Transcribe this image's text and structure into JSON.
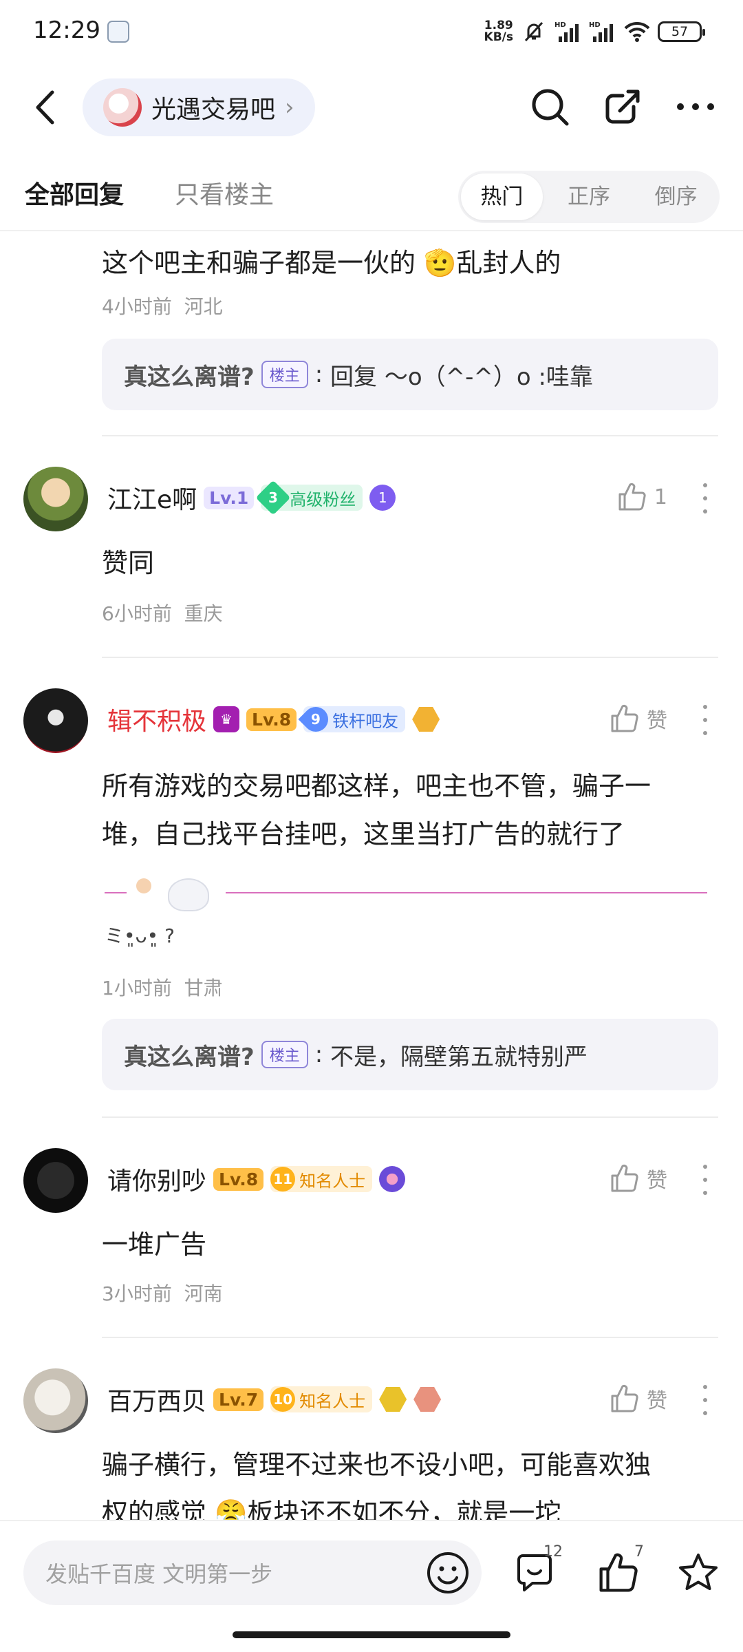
{
  "status_bar": {
    "time": "12:29",
    "net_speed_value": "1.89",
    "net_speed_unit": "KB/s",
    "battery": "57"
  },
  "nav": {
    "forum_name": "光遇交易吧"
  },
  "tabs": {
    "all": "全部回复",
    "owner_only": "只看楼主",
    "sort_hot": "热门",
    "sort_asc": "正序",
    "sort_desc": "倒序"
  },
  "comments": [
    {
      "text": "这个吧主和骗子都是一伙的 🫡乱封人的",
      "time": "4小时前",
      "location": "河北",
      "reply": {
        "name": "真这么离谱?",
        "tag": "楼主",
        "text": "回复 ～o（^-^）o :哇靠"
      }
    },
    {
      "user": "江江e啊",
      "level": "Lv.1",
      "fan_num": "3",
      "fan_title": "高级粉丝",
      "like_label": "1",
      "text": "赞同",
      "time": "6小时前",
      "location": "重庆"
    },
    {
      "user": "辑不积极",
      "level": "Lv.8",
      "fan_num": "9",
      "fan_title": "铁杆吧友",
      "like_label": "赞",
      "text_line1": "所有游戏的交易吧都这样，吧主也不管，骗子一",
      "text_line2": "堆，自己找平台挂吧，这里当打广告的就行了",
      "sig_text": "ミ•͈ᴗ•͈ ?",
      "time": "1小时前",
      "location": "甘肃",
      "reply": {
        "name": "真这么离谱?",
        "tag": "楼主",
        "text": "不是，隔壁第五就特别严"
      }
    },
    {
      "user": "请你别吵",
      "level": "Lv.8",
      "fan_num": "11",
      "fan_title": "知名人士",
      "like_label": "赞",
      "text": "一堆广告",
      "time": "3小时前",
      "location": "河南"
    },
    {
      "user": "百万西贝",
      "level": "Lv.7",
      "fan_num": "10",
      "fan_title": "知名人士",
      "like_label": "赞",
      "text_line1": "骗子横行，管理不过来也不设小吧，可能喜欢独",
      "text_line2": "权的感觉 😤板块还不如不分，就是一坨"
    }
  ],
  "bottom_bar": {
    "input_placeholder": "发贴千百度 文明第一步",
    "comment_count": "12",
    "like_count": "7"
  }
}
